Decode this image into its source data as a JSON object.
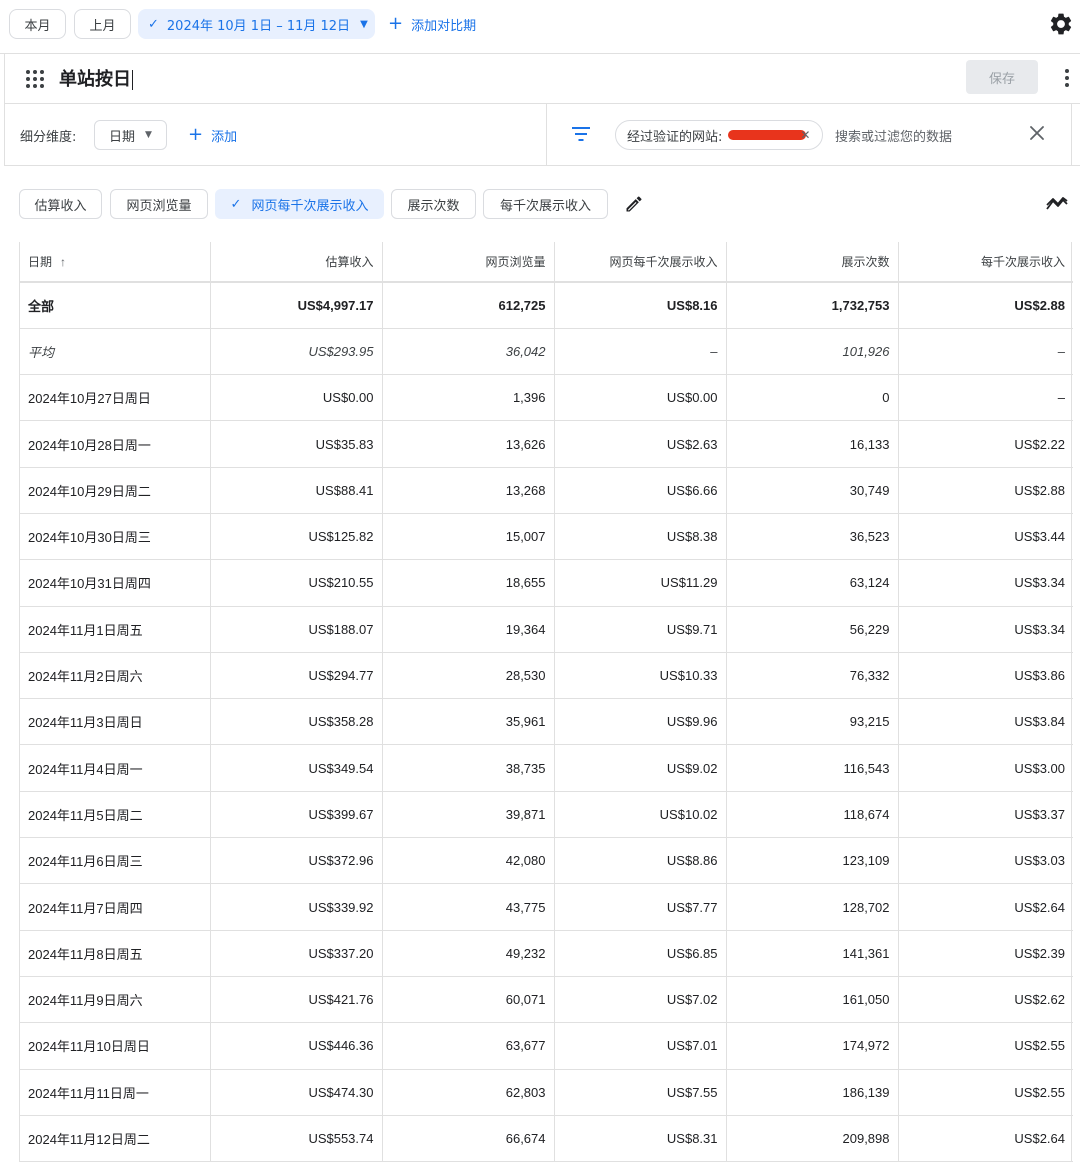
{
  "topbar": {
    "this_month": "本月",
    "last_month": "上月",
    "date_range": "2024年 10月 1日 – 11月 12日",
    "add_compare": "添加对比期"
  },
  "report": {
    "title": "单站按日",
    "save_label": "保存"
  },
  "filters": {
    "dimension_label": "细分维度:",
    "dimension_value": "日期",
    "add_label": "添加",
    "site_chip_label": "经过验证的网站:",
    "search_placeholder": "搜索或过滤您的数据"
  },
  "metrics": [
    {
      "label": "估算收入",
      "active": false
    },
    {
      "label": "网页浏览量",
      "active": false
    },
    {
      "label": "网页每千次展示收入",
      "active": true
    },
    {
      "label": "展示次数",
      "active": false
    },
    {
      "label": "每千次展示收入",
      "active": false
    }
  ],
  "table": {
    "columns": [
      "日期",
      "估算收入",
      "网页浏览量",
      "网页每千次展示收入",
      "展示次数",
      "每千次展示收入"
    ],
    "total": [
      "全部",
      "US$4,997.17",
      "612,725",
      "US$8.16",
      "1,732,753",
      "US$2.88"
    ],
    "average": [
      "平均",
      "US$293.95",
      "36,042",
      "–",
      "101,926",
      "–"
    ],
    "rows": [
      [
        "2024年10月27日周日",
        "US$0.00",
        "1,396",
        "US$0.00",
        "0",
        "–"
      ],
      [
        "2024年10月28日周一",
        "US$35.83",
        "13,626",
        "US$2.63",
        "16,133",
        "US$2.22"
      ],
      [
        "2024年10月29日周二",
        "US$88.41",
        "13,268",
        "US$6.66",
        "30,749",
        "US$2.88"
      ],
      [
        "2024年10月30日周三",
        "US$125.82",
        "15,007",
        "US$8.38",
        "36,523",
        "US$3.44"
      ],
      [
        "2024年10月31日周四",
        "US$210.55",
        "18,655",
        "US$11.29",
        "63,124",
        "US$3.34"
      ],
      [
        "2024年11月1日周五",
        "US$188.07",
        "19,364",
        "US$9.71",
        "56,229",
        "US$3.34"
      ],
      [
        "2024年11月2日周六",
        "US$294.77",
        "28,530",
        "US$10.33",
        "76,332",
        "US$3.86"
      ],
      [
        "2024年11月3日周日",
        "US$358.28",
        "35,961",
        "US$9.96",
        "93,215",
        "US$3.84"
      ],
      [
        "2024年11月4日周一",
        "US$349.54",
        "38,735",
        "US$9.02",
        "116,543",
        "US$3.00"
      ],
      [
        "2024年11月5日周二",
        "US$399.67",
        "39,871",
        "US$10.02",
        "118,674",
        "US$3.37"
      ],
      [
        "2024年11月6日周三",
        "US$372.96",
        "42,080",
        "US$8.86",
        "123,109",
        "US$3.03"
      ],
      [
        "2024年11月7日周四",
        "US$339.92",
        "43,775",
        "US$7.77",
        "128,702",
        "US$2.64"
      ],
      [
        "2024年11月8日周五",
        "US$337.20",
        "49,232",
        "US$6.85",
        "141,361",
        "US$2.39"
      ],
      [
        "2024年11月9日周六",
        "US$421.76",
        "60,071",
        "US$7.02",
        "161,050",
        "US$2.62"
      ],
      [
        "2024年11月10日周日",
        "US$446.36",
        "63,677",
        "US$7.01",
        "174,972",
        "US$2.55"
      ],
      [
        "2024年11月11日周一",
        "US$474.30",
        "62,803",
        "US$7.55",
        "186,139",
        "US$2.55"
      ],
      [
        "2024年11月12日周二",
        "US$553.74",
        "66,674",
        "US$8.31",
        "209,898",
        "US$2.64"
      ]
    ]
  },
  "icons": {
    "settings": "gear-icon",
    "apps": "apps-grid-icon",
    "more": "more-vert-icon",
    "filter": "filter-icon",
    "close": "close-icon",
    "edit": "pencil-icon",
    "chart": "trend-icon"
  },
  "colors": {
    "accent": "#1a73e8",
    "chip_active_bg": "#e8f0fe",
    "redaction": "#e8341c"
  }
}
